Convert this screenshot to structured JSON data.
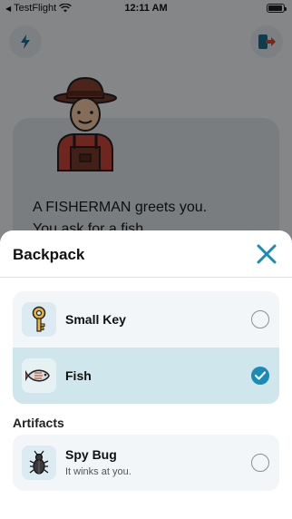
{
  "status_bar": {
    "back_app": "TestFlight",
    "time": "12:11 AM"
  },
  "dialog": {
    "line1": "A FISHERMAN greets you.",
    "line2": "You ask for a fish."
  },
  "backpack": {
    "title": "Backpack",
    "items": [
      {
        "name": "Small Key",
        "icon": "key-icon",
        "selected": false
      },
      {
        "name": "Fish",
        "icon": "fish-icon",
        "selected": true
      }
    ],
    "artifacts_label": "Artifacts",
    "artifacts": [
      {
        "name": "Spy Bug",
        "description": "It winks at you.",
        "icon": "bug-icon",
        "selected": false
      }
    ]
  },
  "colors": {
    "accent": "#1a8bb5",
    "selected_row": "#cfe6ec",
    "scrim": "rgba(0,0,0,0.45)"
  }
}
